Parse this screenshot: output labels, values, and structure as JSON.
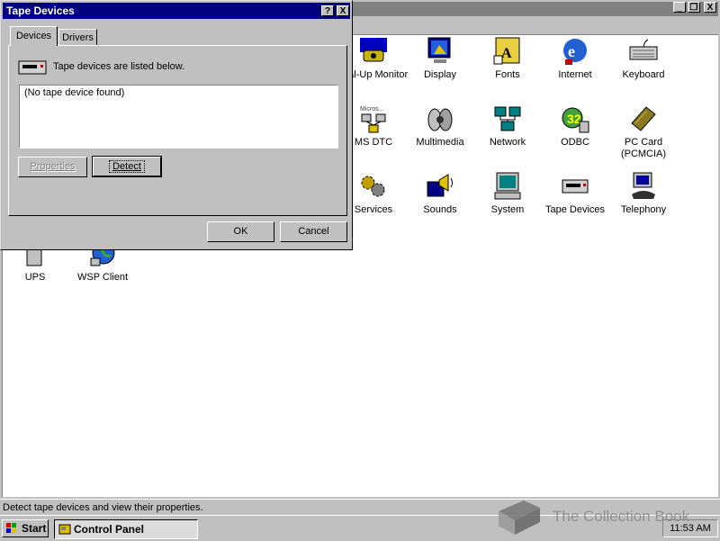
{
  "dialog": {
    "title": "Tape Devices",
    "help_button": "?",
    "close_button": "X",
    "tabs": [
      {
        "label": "Devices"
      },
      {
        "label": "Drivers"
      }
    ],
    "info_text": "Tape devices are listed below.",
    "list_items": [
      "(No tape device found)"
    ],
    "properties_label": "Properties",
    "detect_label": "Detect",
    "ok_label": "OK",
    "cancel_label": "Cancel"
  },
  "control_panel": {
    "icons": [
      {
        "label": "Dial-Up Monitor",
        "icon": "dialup-monitor-icon"
      },
      {
        "label": "Display",
        "icon": "display-icon"
      },
      {
        "label": "Fonts",
        "icon": "fonts-icon"
      },
      {
        "label": "Internet",
        "icon": "internet-icon"
      },
      {
        "label": "Keyboard",
        "icon": "keyboard-icon"
      },
      {
        "label": "MS DTC",
        "icon": "msdtc-icon",
        "icon_caption": "Micros..."
      },
      {
        "label": "Multimedia",
        "icon": "multimedia-icon"
      },
      {
        "label": "Network",
        "icon": "network-icon"
      },
      {
        "label": "ODBC",
        "icon": "odbc-icon"
      },
      {
        "label": "PC Card (PCMCIA)",
        "icon": "pccard-icon"
      },
      {
        "label": "Services",
        "icon": "services-icon"
      },
      {
        "label": "Sounds",
        "icon": "sounds-icon"
      },
      {
        "label": "System",
        "icon": "system-icon"
      },
      {
        "label": "Tape Devices",
        "icon": "tape-devices-icon"
      },
      {
        "label": "Telephony",
        "icon": "telephony-icon"
      },
      {
        "label": "UPS",
        "icon": "ups-icon"
      },
      {
        "label": "WSP Client",
        "icon": "wsp-client-icon"
      }
    ]
  },
  "window_buttons": [
    "_",
    "❐",
    "X"
  ],
  "status_bar": {
    "text": "Detect tape devices and view their properties."
  },
  "taskbar": {
    "start_label": "Start",
    "task_label": "Control Panel",
    "clock": "11:53 AM"
  },
  "watermark": {
    "text": "The Collection Book"
  }
}
